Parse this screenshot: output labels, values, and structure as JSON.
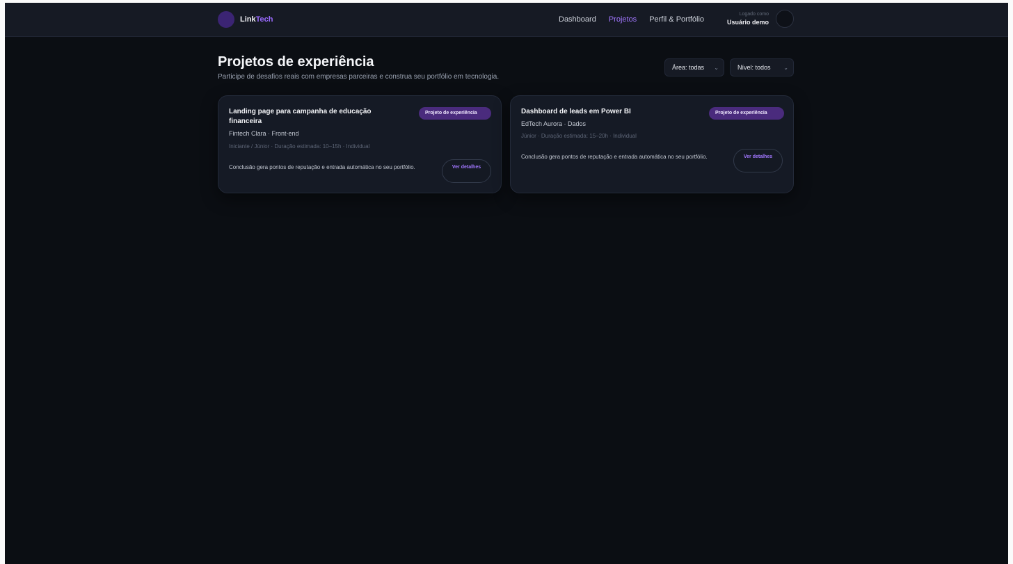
{
  "brand": {
    "name_main": "Link",
    "name_accent": "Tech"
  },
  "nav": {
    "items": [
      {
        "label": "Dashboard",
        "active": false
      },
      {
        "label": "Projetos",
        "active": true
      },
      {
        "label": "Perfil & Portfólio",
        "active": false
      }
    ]
  },
  "user": {
    "caption": "Logado como",
    "name": "Usuário demo"
  },
  "page": {
    "title": "Projetos de experiência",
    "subtitle": "Participe de desafios reais com empresas parceiras e construa seu portfólio em tecnologia."
  },
  "filters": {
    "area": {
      "label": "Área: todas"
    },
    "nivel": {
      "label": "Nível: todos"
    }
  },
  "projects": [
    {
      "title": "Landing page para campanha de educação financeira",
      "company": "Fintech Clara · Front-end",
      "meta": "Iniciante / Júnior · Duração estimada: 10–15h · Individual",
      "badge": "Projeto de experiência",
      "description": "Conclusão gera pontos de reputação e entrada automática no seu portfólio.",
      "button": "Ver detalhes"
    },
    {
      "title": "Dashboard de leads em Power BI",
      "company": "EdTech Aurora · Dados",
      "meta": "Júnior · Duração estimada: 15–20h · Individual",
      "badge": "Projeto de experiência",
      "description": "Conclusão gera pontos de reputação e entrada automática no seu portfólio.",
      "button": "Ver detalhes"
    }
  ],
  "colors": {
    "accent": "#a277ff",
    "badge_bg": "#4a2b7d",
    "background": "#0b0e13",
    "card_bg": "#151a25",
    "topbar_bg": "#161a24"
  },
  "icons": {
    "select_chevron": "chevron-down-icon"
  }
}
